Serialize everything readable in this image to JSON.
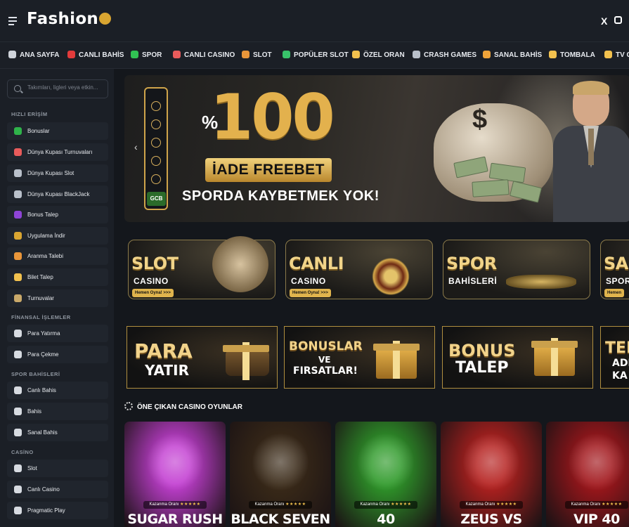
{
  "header": {
    "logo": "Fashion",
    "social": [
      "X",
      "instagram-icon"
    ]
  },
  "nav": [
    {
      "label": "ANA SAYFA",
      "icon": "home-icon",
      "color": "#cfd3da"
    },
    {
      "label": "CANLI BAHİS",
      "icon": "live-bet-icon",
      "color": "#e23b3b"
    },
    {
      "label": "SPOR",
      "icon": "sport-icon",
      "color": "#31c253"
    },
    {
      "label": "CANLI CASINO",
      "icon": "live-casino-icon",
      "color": "#e85b5b"
    },
    {
      "label": "SLOT",
      "icon": "slot-icon",
      "color": "#e9963a"
    },
    {
      "label": "POPÜLER SLOT",
      "icon": "star-icon",
      "color": "#38c26a"
    },
    {
      "label": "ÖZEL ORAN",
      "icon": "sun-icon",
      "color": "#f2c14e"
    },
    {
      "label": "CRASH GAMES",
      "icon": "rocket-icon",
      "color": "#b9c0ca"
    },
    {
      "label": "SANAL BAHİS",
      "icon": "virtual-icon",
      "color": "#f0a43a"
    },
    {
      "label": "TOMBALA",
      "icon": "tombala-icon",
      "color": "#f2c14e"
    },
    {
      "label": "TV G",
      "icon": "tv-icon",
      "color": "#f2c14e"
    }
  ],
  "sidebar": {
    "search_placeholder": "Takımları, ligleri veya etkin...",
    "sections": [
      {
        "title": "HIZLI ERİŞİM",
        "items": [
          {
            "label": "Bonuslar",
            "icon": "gift-icon",
            "color": "#2fb34a"
          },
          {
            "label": "Dünya Kupası Turnuvaları",
            "icon": "trophy-icon",
            "color": "#e85b5b"
          },
          {
            "label": "Dünya Kupası Slot",
            "icon": "ball-icon",
            "color": "#b9c0ca"
          },
          {
            "label": "Dünya Kupası BlackJack",
            "icon": "ball-icon",
            "color": "#b9c0ca"
          },
          {
            "label": "Bonus Talep",
            "icon": "bonus-request-icon",
            "color": "#8e44d6"
          },
          {
            "label": "Uygulama İndir",
            "icon": "download-icon",
            "color": "#d9a531"
          },
          {
            "label": "Aranma Talebi",
            "icon": "phone-icon",
            "color": "#e9963a"
          },
          {
            "label": "Bilet Talep",
            "icon": "ticket-icon",
            "color": "#f2c14e"
          },
          {
            "label": "Turnuvalar",
            "icon": "chart-icon",
            "color": "#c9a96a"
          }
        ]
      },
      {
        "title": "FİNANSAL İŞLEMLER",
        "items": [
          {
            "label": "Para Yatırma",
            "icon": "wallet-in-icon",
            "color": "#d7dbe1"
          },
          {
            "label": "Para Çekme",
            "icon": "wallet-out-icon",
            "color": "#d7dbe1"
          }
        ]
      },
      {
        "title": "SPOR BAHİSLERİ",
        "items": [
          {
            "label": "Canlı Bahis",
            "icon": "live-icon",
            "color": "#d7dbe1"
          },
          {
            "label": "Bahis",
            "icon": "soccer-icon",
            "color": "#d7dbe1"
          },
          {
            "label": "Sanal Bahis",
            "icon": "virtual-icon",
            "color": "#d7dbe1"
          }
        ]
      },
      {
        "title": "CASİNO",
        "items": [
          {
            "label": "Slot",
            "icon": "slot-icon",
            "color": "#d7dbe1"
          },
          {
            "label": "Canlı Casino",
            "icon": "chip-icon",
            "color": "#d7dbe1"
          },
          {
            "label": "Pragmatic Play",
            "icon": "pragmatic-icon",
            "color": "#d7dbe1"
          }
        ]
      }
    ]
  },
  "hero": {
    "percent": "%",
    "amount": "100",
    "freebet": "İADE FREEBET",
    "subtitle": "SPORDA KAYBETMEK YOK!",
    "badge": "GCB",
    "bag_symbol": "$"
  },
  "categories": [
    {
      "title": "SLOT",
      "subtitle": "CASINO",
      "button": "Hemen Oyna! >>>"
    },
    {
      "title": "CANLI",
      "subtitle": "CASINO",
      "button": "Hemen Oyna! >>>"
    },
    {
      "title": "SPOR",
      "subtitle": "BAHİSLERİ",
      "button": ""
    },
    {
      "title": "SA",
      "subtitle": "SPOR",
      "button": "Hemen"
    }
  ],
  "promos": [
    {
      "line1": "PARA",
      "line2": "YATIR"
    },
    {
      "line1": "BONUSLAR",
      "line2": "VE",
      "line3": "FIRSATLAR!"
    },
    {
      "line1": "BONUS",
      "line2": "TALEP"
    },
    {
      "line1": "TEL",
      "line2": "ADR",
      "line3": "KA"
    }
  ],
  "featured": {
    "title": "ÖNE ÇIKAN CASINO OYUNLAR",
    "games": [
      {
        "name": "SUGAR RUSH",
        "rate_label": "Kazanma Oranı",
        "stars": "★★★★★",
        "bg": "#c33fd2"
      },
      {
        "name": "BLACK SEVEN",
        "rate_label": "Kazanma Oranı",
        "stars": "★★★★★",
        "bg": "#3a2a18"
      },
      {
        "name": "40",
        "rate_label": "Kazanma Oranı",
        "stars": "★★★★★",
        "bg": "#2f9a2a"
      },
      {
        "name": "ZEUS VS",
        "rate_label": "Kazanma Oranı",
        "stars": "★★★★★",
        "bg": "#b5211f"
      },
      {
        "name": "VIP 40",
        "rate_label": "Kazanma Oranı",
        "stars": "★★★★★",
        "bg": "#a1161b"
      }
    ]
  }
}
